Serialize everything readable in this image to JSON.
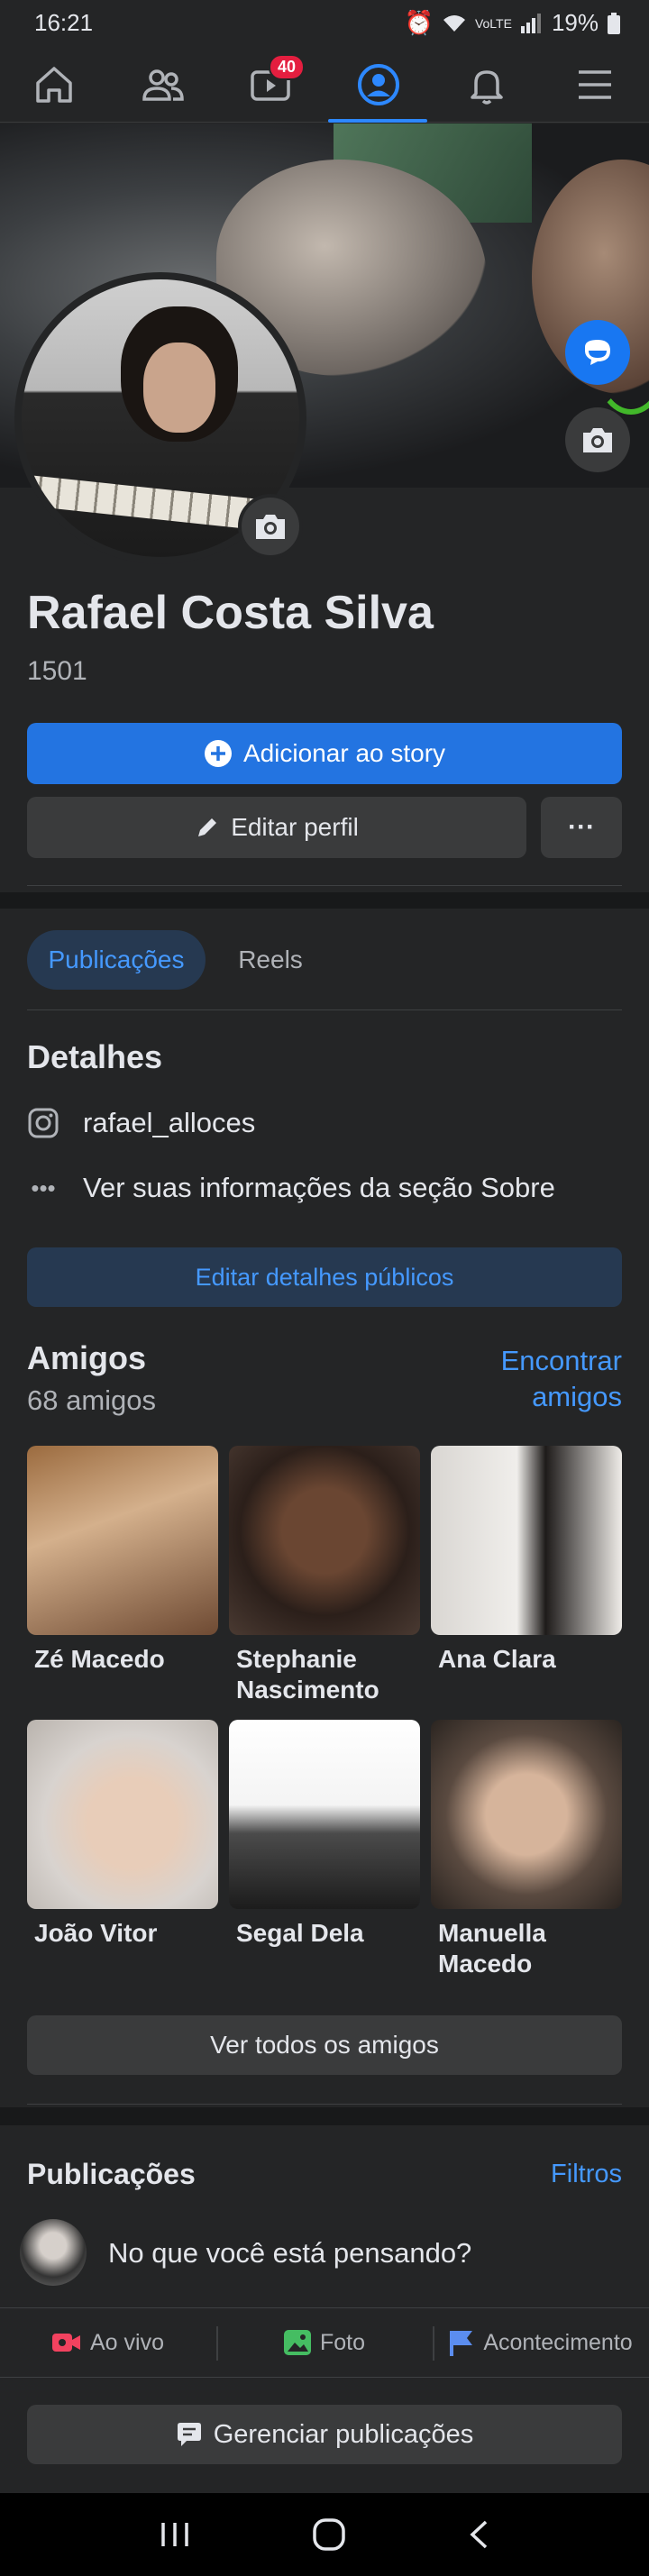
{
  "status_bar": {
    "time": "16:21",
    "network": "VoLTE",
    "battery": "19%"
  },
  "nav": {
    "video_badge": "40"
  },
  "profile": {
    "name": "Rafael Costa Silva",
    "count": "1501",
    "add_story_label": "Adicionar ao story",
    "edit_profile_label": "Editar perfil",
    "more_label": "···"
  },
  "tabs": [
    {
      "label": "Publicações",
      "active": true
    },
    {
      "label": "Reels",
      "active": false
    }
  ],
  "details": {
    "title": "Detalhes",
    "instagram": "rafael_alloces",
    "about": "Ver suas informações da seção Sobre",
    "edit_button": "Editar detalhes públicos"
  },
  "friends": {
    "title": "Amigos",
    "count": "68 amigos",
    "find_label": "Encontrar amigos",
    "items": [
      {
        "name": "Zé Macedo"
      },
      {
        "name": "Stephanie Nascimento B..."
      },
      {
        "name": "Ana Clara"
      },
      {
        "name": "João Vitor"
      },
      {
        "name": "Segal Dela"
      },
      {
        "name": "Manuella Macedo"
      }
    ],
    "see_all_label": "Ver todos os amigos"
  },
  "posts": {
    "title": "Publicações",
    "filters_label": "Filtros",
    "composer_placeholder": "No que você está pensando?",
    "actions": [
      {
        "label": "Ao vivo",
        "icon": "live-video-icon",
        "color": "#f3425f"
      },
      {
        "label": "Foto",
        "icon": "photo-icon",
        "color": "#45bd62"
      },
      {
        "label": "Acontecimento",
        "icon": "flag-icon",
        "color": "#5b8def"
      }
    ],
    "manage_label": "Gerenciar publicações"
  },
  "colors": {
    "accent": "#2374e1",
    "link": "#4599ff",
    "background": "#242526",
    "separator": "#18191a"
  }
}
